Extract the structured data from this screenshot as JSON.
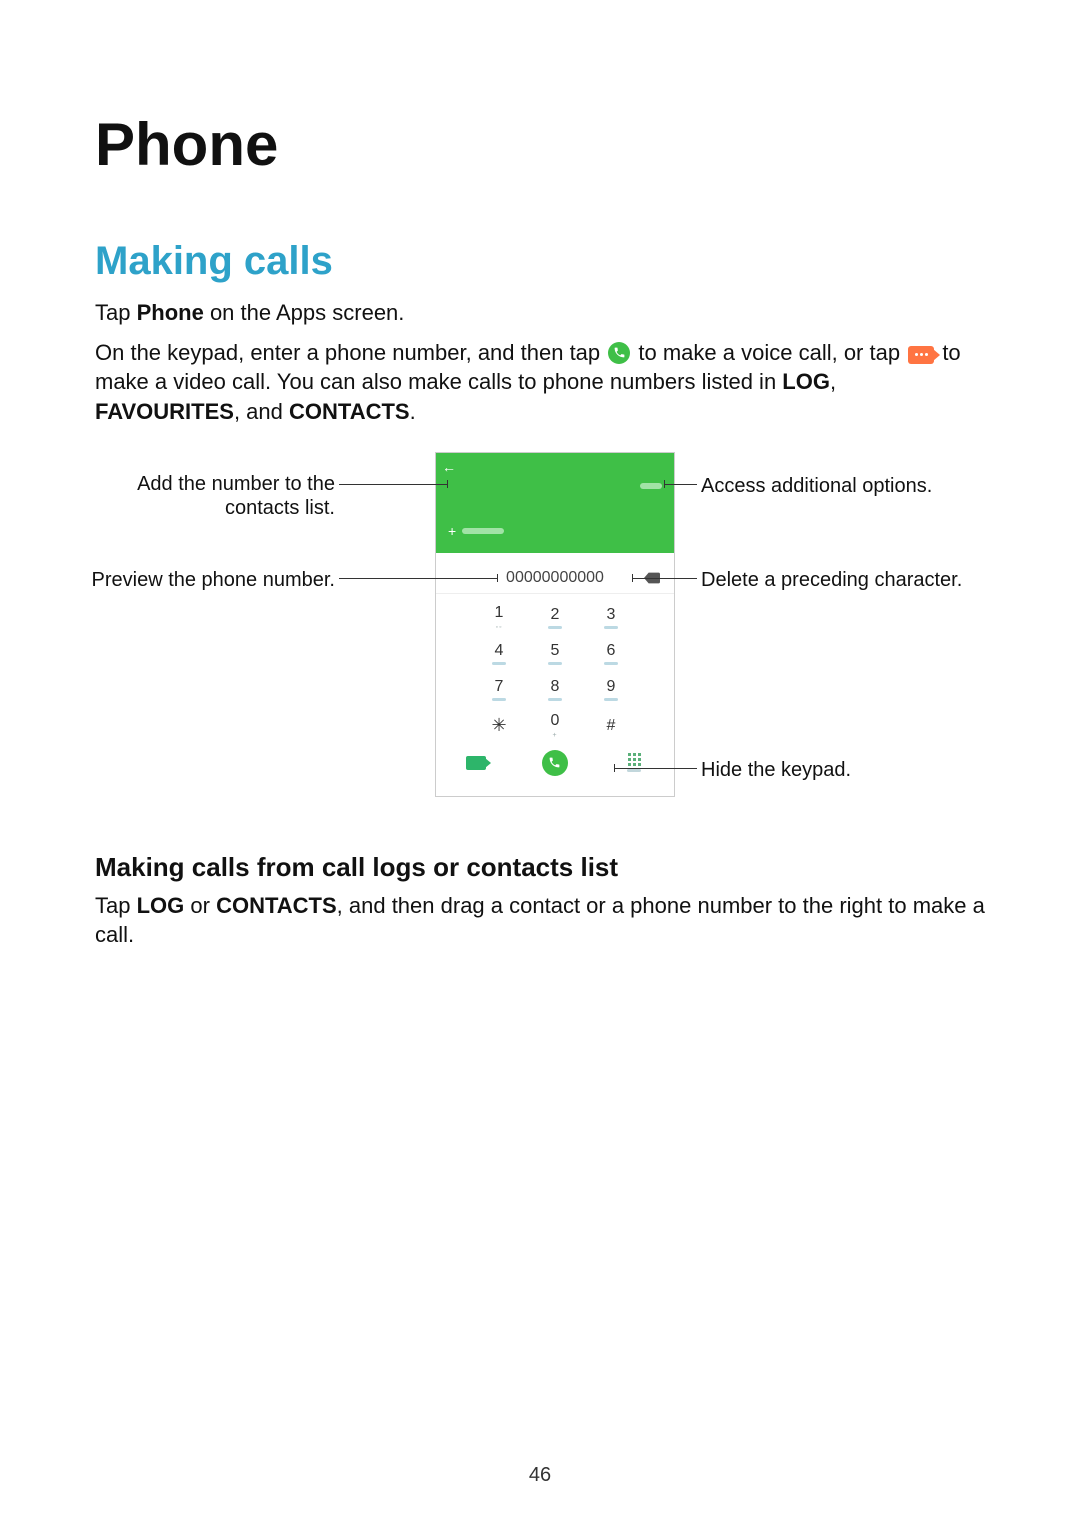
{
  "page_number": "46",
  "h1": "Phone",
  "h2": "Making calls",
  "p1_a": "Tap ",
  "p1_b": "Phone",
  "p1_c": " on the Apps screen.",
  "p2_a": "On the keypad, enter a phone number, and then tap ",
  "p2_b": " to make a voice call, or tap ",
  "p2_c": " to make a video call. You can also make calls to phone numbers listed in ",
  "p2_log": "LOG",
  "p2_sep1": ", ",
  "p2_fav": "FAVOURITES",
  "p2_sep2": ", and ",
  "p2_con": "CONTACTS",
  "p2_end": ".",
  "callouts": {
    "add_contact": "Add the number to the contacts list.",
    "preview": "Preview the phone number.",
    "options": "Access additional options.",
    "delete": "Delete a preceding character.",
    "hide": "Hide the keypad."
  },
  "phone": {
    "number_display": "00000000000",
    "keys": {
      "k1": "1",
      "k2": "2",
      "k3": "3",
      "k4": "4",
      "k5": "5",
      "k6": "6",
      "k7": "7",
      "k8": "8",
      "k9": "9",
      "kstar": "✳",
      "k0": "0",
      "khash": "#"
    }
  },
  "h3": "Making calls from call logs or contacts list",
  "p3_a": "Tap ",
  "p3_log": "LOG",
  "p3_b": " or ",
  "p3_con": "CONTACTS",
  "p3_c": ", and then drag a contact or a phone number to the right to make a call."
}
